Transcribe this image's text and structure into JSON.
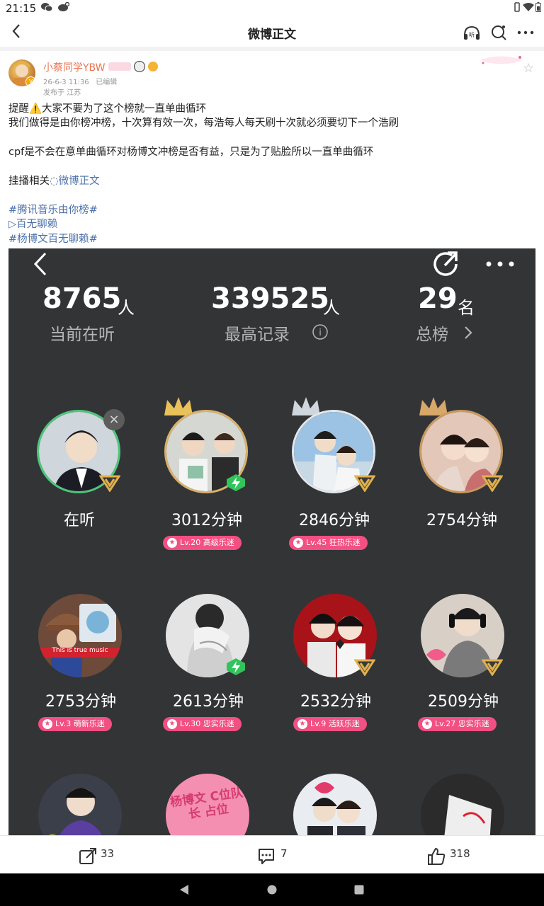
{
  "status_bar": {
    "time": "21:15"
  },
  "nav": {
    "title": "微博正文"
  },
  "post": {
    "author": "小蔡同学YBW",
    "timestamp": "26-6-3 11:36",
    "edited": "已编辑",
    "location": "发布于 江苏",
    "lines": [
      "提醒⚠️大家不要为了这个榜就一直单曲循环",
      "我们做得是由你榜冲榜，十次算有效一次，每浩每人每天刷十次就必须要切下一个浩刷",
      "cpf是不会在意单曲循环对杨博文冲榜是否有益，只是为了贴脸所以一直单曲循环",
      "挂播相关"
    ],
    "inline_link": "微博正文",
    "hashtag1": "#腾讯音乐由你榜#",
    "song_link": "▷百无聊赖",
    "hashtag2": "#杨博文百无聊赖#"
  },
  "screenshot": {
    "stats": [
      {
        "value": "8765",
        "unit": "人",
        "label": "当前在听"
      },
      {
        "value": "339525",
        "unit": "人",
        "label": "最高记录"
      },
      {
        "value": "29",
        "unit": "名",
        "label": "总榜"
      }
    ],
    "listeners": [
      {
        "label": "在听",
        "badge": ""
      },
      {
        "label": "3012分钟",
        "badge": "Lv.20 高级乐迷"
      },
      {
        "label": "2846分钟",
        "badge": "Lv.45 狂热乐迷"
      },
      {
        "label": "2754分钟",
        "badge": ""
      },
      {
        "label": "2753分钟",
        "badge": "Lv.3 萌新乐迷"
      },
      {
        "label": "2613分钟",
        "badge": "Lv.30 忠实乐迷"
      },
      {
        "label": "2532分钟",
        "badge": "Lv.9 活跃乐迷"
      },
      {
        "label": "2509分钟",
        "badge": "Lv.27 忠实乐迷"
      }
    ],
    "avatar5_caption": "This is true music",
    "avatar10_text": "杨博文 C位队长 占位"
  },
  "actions": {
    "repost_count": "33",
    "comment_count": "7",
    "like_count": "318"
  },
  "icons": [
    "back-icon",
    "headphone-icon",
    "search-icon",
    "more-icon",
    "share-icon",
    "comment-icon",
    "like-icon",
    "crown-icon",
    "v-badge-icon",
    "bolt-badge-icon",
    "info-icon",
    "chevron-right-icon"
  ],
  "colors": {
    "username": "#eb7350",
    "link": "#4b6fa8",
    "badge_pink": "#f24f82",
    "panel_bg": "#333436"
  }
}
